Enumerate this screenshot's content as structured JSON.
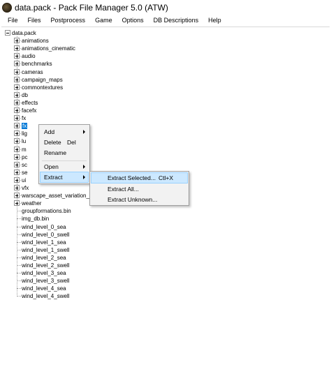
{
  "window": {
    "title": "data.pack - Pack File Manager 5.0 (ATW)"
  },
  "menu": [
    "File",
    "Files",
    "Postprocess",
    "Game",
    "Options",
    "DB Descriptions",
    "Help"
  ],
  "tree": {
    "root": "data.pack",
    "folders": [
      "animations",
      "animations_cinematic",
      "audio",
      "benchmarks",
      "cameras",
      "campaign_maps",
      "commontextures",
      "db",
      "effects",
      "facefx",
      "fx",
      "fx",
      "lig",
      "lu",
      "m",
      "pc",
      "sc",
      "se",
      "ui",
      "vfx",
      "warscape_asset_variation_db",
      "weather"
    ],
    "files": [
      "groupformations.bin",
      "img_db.bin",
      "wind_level_0_sea",
      "wind_level_0_swell",
      "wind_level_1_sea",
      "wind_level_1_swell",
      "wind_level_2_sea",
      "wind_level_2_swell",
      "wind_level_3_sea",
      "wind_level_3_swell",
      "wind_level_4_sea",
      "wind_level_4_swell"
    ]
  },
  "context_menu": {
    "items": [
      {
        "label": "Add",
        "shortcut": "",
        "submenu": true
      },
      {
        "label": "Delete",
        "shortcut": "Del",
        "submenu": false
      },
      {
        "label": "Rename",
        "shortcut": "",
        "submenu": false
      },
      {
        "label": "Open",
        "shortcut": "",
        "submenu": true
      },
      {
        "label": "Extract",
        "shortcut": "",
        "submenu": true
      }
    ]
  },
  "extract_submenu": {
    "items": [
      {
        "label": "Extract Selected...",
        "shortcut": "Ctl+X"
      },
      {
        "label": "Extract All..."
      },
      {
        "label": "Extract Unknown..."
      }
    ]
  },
  "colors": {
    "selection": "#0078d7",
    "menu_highlight": "#cce8ff",
    "menu_highlight_border": "#99d1ff",
    "menu_background": "#f2f2f2"
  }
}
